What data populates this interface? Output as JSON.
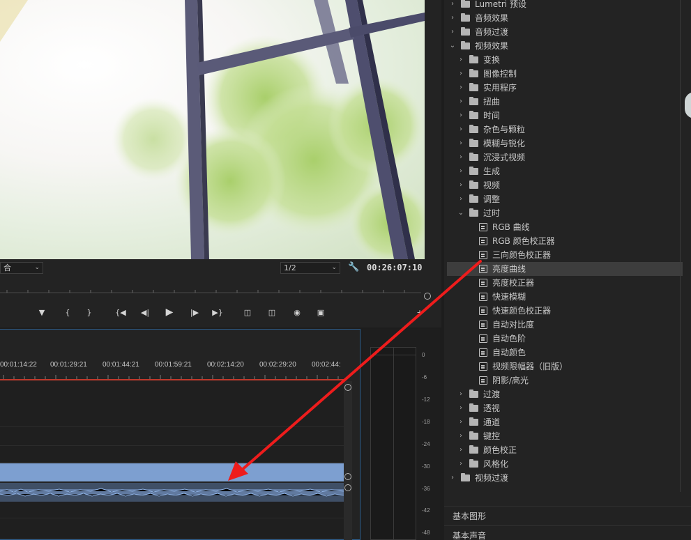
{
  "monitor": {
    "fit_label": "合",
    "resolution": "1/2",
    "timecode": "00:26:07:10",
    "controls": [
      "marker",
      "mark-in",
      "mark-out",
      "go-to-in",
      "step-back",
      "play",
      "step-forward",
      "go-to-out",
      "lift",
      "extract",
      "export-frame",
      "compare"
    ]
  },
  "timeline": {
    "timestamps": [
      "00:01:14:22",
      "00:01:29:21",
      "00:01:44:21",
      "00:01:59:21",
      "00:02:14:20",
      "00:02:29:20",
      "00:02:44:"
    ]
  },
  "meter": {
    "db_labels": [
      "0",
      "-6",
      "-12",
      "-18",
      "-24",
      "-30",
      "-36",
      "-42",
      "-48"
    ]
  },
  "effects": {
    "tree": [
      {
        "label": "Lumetri 预设",
        "level": 0,
        "kind": "folder-special",
        "expanded": false
      },
      {
        "label": "音频效果",
        "level": 0,
        "kind": "folder",
        "expanded": false
      },
      {
        "label": "音频过渡",
        "level": 0,
        "kind": "folder",
        "expanded": false
      },
      {
        "label": "视频效果",
        "level": 0,
        "kind": "folder",
        "expanded": true
      },
      {
        "label": "变换",
        "level": 1,
        "kind": "folder",
        "expanded": false
      },
      {
        "label": "图像控制",
        "level": 1,
        "kind": "folder",
        "expanded": false
      },
      {
        "label": "实用程序",
        "level": 1,
        "kind": "folder",
        "expanded": false
      },
      {
        "label": "扭曲",
        "level": 1,
        "kind": "folder",
        "expanded": false
      },
      {
        "label": "时间",
        "level": 1,
        "kind": "folder",
        "expanded": false
      },
      {
        "label": "杂色与颗粒",
        "level": 1,
        "kind": "folder",
        "expanded": false
      },
      {
        "label": "模糊与锐化",
        "level": 1,
        "kind": "folder",
        "expanded": false
      },
      {
        "label": "沉浸式视频",
        "level": 1,
        "kind": "folder",
        "expanded": false
      },
      {
        "label": "生成",
        "level": 1,
        "kind": "folder",
        "expanded": false
      },
      {
        "label": "视频",
        "level": 1,
        "kind": "folder",
        "expanded": false
      },
      {
        "label": "调整",
        "level": 1,
        "kind": "folder",
        "expanded": false
      },
      {
        "label": "过时",
        "level": 1,
        "kind": "folder",
        "expanded": true
      },
      {
        "label": "RGB 曲线",
        "level": 2,
        "kind": "effect"
      },
      {
        "label": "RGB 颜色校正器",
        "level": 2,
        "kind": "effect"
      },
      {
        "label": "三向颜色校正器",
        "level": 2,
        "kind": "effect"
      },
      {
        "label": "亮度曲线",
        "level": 2,
        "kind": "effect",
        "selected": true
      },
      {
        "label": "亮度校正器",
        "level": 2,
        "kind": "effect"
      },
      {
        "label": "快速模糊",
        "level": 2,
        "kind": "effect"
      },
      {
        "label": "快速颜色校正器",
        "level": 2,
        "kind": "effect"
      },
      {
        "label": "自动对比度",
        "level": 2,
        "kind": "effect"
      },
      {
        "label": "自动色阶",
        "level": 2,
        "kind": "effect"
      },
      {
        "label": "自动颜色",
        "level": 2,
        "kind": "effect"
      },
      {
        "label": "视频限幅器（旧版）",
        "level": 2,
        "kind": "effect"
      },
      {
        "label": "阴影/高光",
        "level": 2,
        "kind": "effect"
      },
      {
        "label": "过渡",
        "level": 1,
        "kind": "folder",
        "expanded": false
      },
      {
        "label": "透视",
        "level": 1,
        "kind": "folder",
        "expanded": false
      },
      {
        "label": "通道",
        "level": 1,
        "kind": "folder",
        "expanded": false
      },
      {
        "label": "键控",
        "level": 1,
        "kind": "folder",
        "expanded": false
      },
      {
        "label": "颜色校正",
        "level": 1,
        "kind": "folder",
        "expanded": false
      },
      {
        "label": "风格化",
        "level": 1,
        "kind": "folder",
        "expanded": false
      },
      {
        "label": "视频过渡",
        "level": 0,
        "kind": "folder",
        "expanded": false
      }
    ]
  },
  "panels": {
    "basic_graphics": "基本图形",
    "basic_sound": "基本声音"
  },
  "colors": {
    "accent_arrow": "#ee1c1c",
    "clip_blue": "#7d9fd0",
    "timeline_border": "#2c5d8c",
    "playhead_red": "#c0392b"
  }
}
